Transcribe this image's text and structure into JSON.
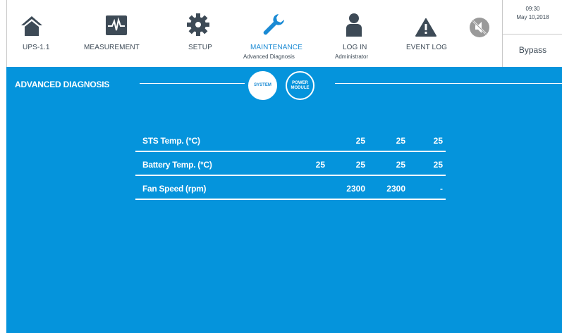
{
  "navbar": {
    "items": [
      {
        "label": "UPS-1.1",
        "sub": "",
        "icon": "home-icon"
      },
      {
        "label": "MEASUREMENT",
        "sub": "",
        "icon": "waveform-icon"
      },
      {
        "label": "SETUP",
        "sub": "",
        "icon": "gear-icon"
      },
      {
        "label": "MAINTENANCE",
        "sub": "Advanced Diagnosis",
        "icon": "wrench-icon"
      },
      {
        "label": "LOG IN",
        "sub": "Administrator",
        "icon": "user-icon"
      },
      {
        "label": "EVENT LOG",
        "sub": "",
        "icon": "warning-icon"
      },
      {
        "label": "",
        "sub": "",
        "icon": "mute-icon"
      }
    ]
  },
  "status": {
    "time": "09:30",
    "date": "May 10,2018",
    "mode": "Bypass"
  },
  "section": {
    "title": "ADVANCED DIAGNOSIS",
    "tabs": [
      {
        "label": "SYSTEM",
        "active": true
      },
      {
        "label": "POWER MODULE",
        "active": false
      }
    ]
  },
  "table": {
    "rows": [
      {
        "label": "STS Temp. (°C)",
        "values": [
          "",
          "25",
          "25",
          "25"
        ]
      },
      {
        "label": "Battery Temp. (°C)",
        "values": [
          "25",
          "25",
          "25",
          "25"
        ]
      },
      {
        "label": "Fan Speed (rpm)",
        "values": [
          "",
          "2300",
          "2300",
          "-"
        ]
      }
    ]
  },
  "colors": {
    "background": "#0594dc",
    "icon": "#3d4a56",
    "active": "#1a8ad4"
  }
}
